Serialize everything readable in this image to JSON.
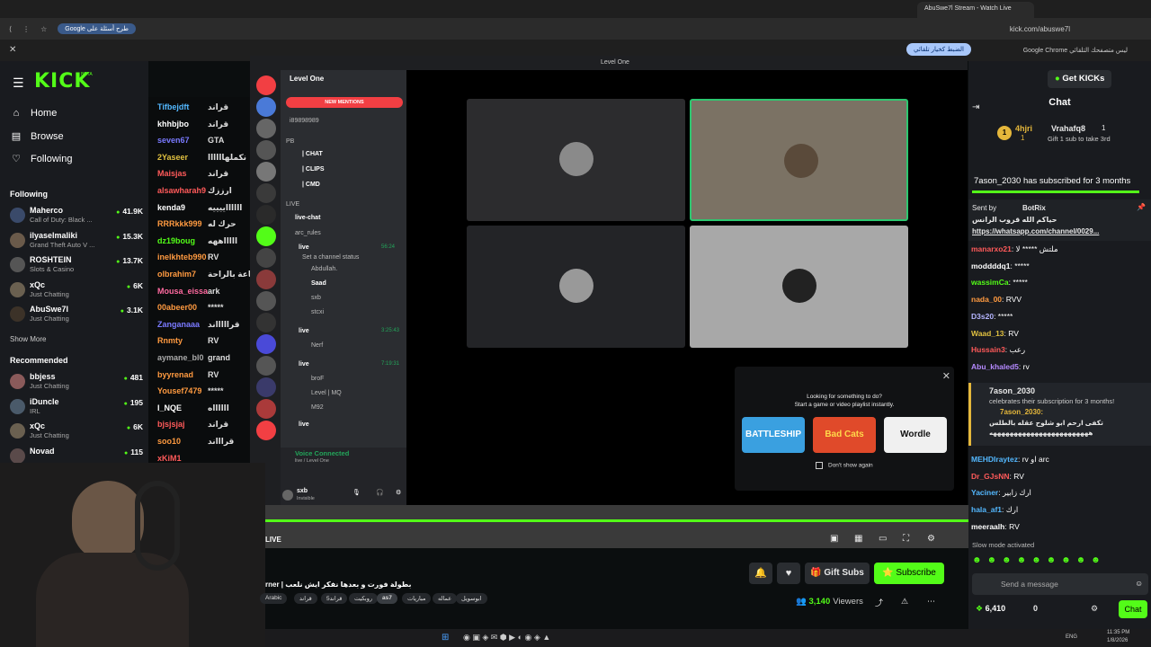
{
  "browser": {
    "tab_title": "AbuSwe7l Stream - Watch Live",
    "url": "kick.com/abuswe7l",
    "google_chip": "Google طرح أسئلة على",
    "infobar_msg": "Google Chrome ليس متصفحك التلقائي",
    "infobar_btn": "الضبط كخيار تلقائي"
  },
  "kick_left": {
    "logo": "KICK",
    "beta": "BETA",
    "nav": [
      {
        "label": "Home",
        "icon": "home-icon"
      },
      {
        "label": "Browse",
        "icon": "browse-icon"
      },
      {
        "label": "Following",
        "icon": "heart-icon"
      }
    ],
    "following_title": "Following",
    "following": [
      {
        "name": "Maherco",
        "cat": "Call of Duty: Black ...",
        "viewers": "41.9K",
        "color": "#3a4a6a"
      },
      {
        "name": "ilyaselmaliki",
        "cat": "Grand Theft Auto V ...",
        "viewers": "15.3K",
        "color": "#6a5a4a"
      },
      {
        "name": "ROSHTEIN",
        "cat": "Slots & Casino",
        "viewers": "13.7K",
        "color": "#555"
      },
      {
        "name": "xQc",
        "cat": "Just Chatting",
        "viewers": "6K",
        "color": "#6a6050"
      },
      {
        "name": "AbuSwe7l",
        "cat": "Just Chatting",
        "viewers": "3.1K",
        "color": "#3c3228"
      }
    ],
    "show_more": "Show More",
    "recommended_title": "Recommended",
    "recommended": [
      {
        "name": "bbjess",
        "cat": "Just Chatting",
        "viewers": "481",
        "color": "#8a5a5a"
      },
      {
        "name": "iDuncle",
        "cat": "IRL",
        "viewers": "195",
        "color": "#4a5a6a"
      },
      {
        "name": "xQc",
        "cat": "Just Chatting",
        "viewers": "6K",
        "color": "#6a6050"
      },
      {
        "name": "Novad",
        "cat": "",
        "viewers": "115",
        "color": "#5a4a4a"
      }
    ]
  },
  "overlay_chat": [
    {
      "user": "Tifbejdft",
      "text": "قراند",
      "color": "#53b8ff"
    },
    {
      "user": "khhbjbo",
      "text": "قراند",
      "color": "#ffffff"
    },
    {
      "user": "seven67",
      "text": "GTA",
      "color": "#7a7aff"
    },
    {
      "user": "2Yaseer",
      "text": "نكملهاااااا",
      "color": "#e0c040"
    },
    {
      "user": "Maisjas",
      "text": "قراند",
      "color": "#ff5a5a"
    },
    {
      "user": "alsawharah9",
      "text": "ارززك",
      "color": "#ff5a5a"
    },
    {
      "user": "kenda9",
      "text": "ااااااييييه",
      "color": "#ffffff"
    },
    {
      "user": "RRRkkk999",
      "text": "حرك له",
      "color": "#ff9a40"
    },
    {
      "user": "dz19boug",
      "text": "اااااههه",
      "color": "#53fc18"
    },
    {
      "user": "inelkhteb990",
      "text": "RV",
      "color": "#ff9a40"
    },
    {
      "user": "olbrahim7",
      "text": "ساعة بالراحة",
      "color": "#ff9a40"
    },
    {
      "user": "Mousa_eissa",
      "text": "ark",
      "color": "#ff6aa0"
    },
    {
      "user": "00abeer00",
      "text": "*****",
      "color": "#ff9a40"
    },
    {
      "user": "Zanganaaa",
      "text": "قراااااند",
      "color": "#7a7aff"
    },
    {
      "user": "Rnmty",
      "text": "RV",
      "color": "#ff9a40"
    },
    {
      "user": "aymane_bl0",
      "text": "grand",
      "color": "#aaaaaa"
    },
    {
      "user": "byyrenad",
      "text": "RV",
      "color": "#ff9a40"
    },
    {
      "user": "Yousef7479",
      "text": "*****",
      "color": "#ff9a40"
    },
    {
      "user": "I_NQE",
      "text": "ااااااه",
      "color": "#ffffff"
    },
    {
      "user": "bjsjsjaj",
      "text": "قراند",
      "color": "#ff5a5a"
    },
    {
      "user": "soo10",
      "text": "قراااند",
      "color": "#ff9a40"
    },
    {
      "user": "xKiM1",
      "text": "",
      "color": "#ff5a5a"
    }
  ],
  "discord": {
    "window_title": "Level One",
    "server_name": "Level One",
    "new_mentions": "NEW MENTIONS",
    "channels": [
      {
        "label": "i89898989",
        "bold": false
      },
      {
        "label": "PB",
        "bold": false
      },
      {
        "label": "| CHAT",
        "bold": true
      },
      {
        "label": "| CLIPS",
        "bold": true
      },
      {
        "label": "| CMD",
        "bold": true
      },
      {
        "label": "LIVE",
        "bold": false
      },
      {
        "label": "live-chat",
        "bold": true
      },
      {
        "label": "arc_rules",
        "bold": false
      },
      {
        "label": "live",
        "bold": true
      },
      {
        "label": "Set a channel status",
        "bold": false
      },
      {
        "label": "Abdullah.",
        "bold": false
      },
      {
        "label": "Saad",
        "bold": true
      },
      {
        "label": "sxb",
        "bold": false
      },
      {
        "label": "stcxi",
        "bold": false
      },
      {
        "label": "live",
        "bold": true
      },
      {
        "label": "Nerf",
        "bold": false
      },
      {
        "label": "live",
        "bold": true
      },
      {
        "label": "broF",
        "bold": false
      },
      {
        "label": "Level | MQ",
        "bold": false
      },
      {
        "label": "M92",
        "bold": false
      },
      {
        "label": "live",
        "bold": true
      }
    ],
    "timers": [
      "56:24",
      "3:25:43",
      "7:19:31"
    ],
    "voice_connected": "Voice Connected",
    "voice_sub": "live / Level One",
    "user": "sxb",
    "user_status": "Invisible",
    "activity_line1": "Looking for something to do?",
    "activity_line2": "Start a game or video playlist instantly.",
    "games": [
      {
        "label": "BATTLESHIP",
        "bg": "#3aa0e0",
        "fg": "#ffffff"
      },
      {
        "label": "Bad Cats",
        "bg": "#e04a2a",
        "fg": "#ffd94a"
      },
      {
        "label": "Wordle",
        "bg": "#f0f0f0",
        "fg": "#111111"
      }
    ],
    "dont_show": "Don't show again"
  },
  "stream": {
    "live_label": "LIVE",
    "title": "rner | بطولة فورت و بعدها نفكر ايش نلعب",
    "tags": [
      "Arabic",
      "قراند",
      "5قراند",
      "روبكيت",
      "as7",
      "مباريات",
      "عماله",
      "ابوسويل"
    ],
    "viewers": "3,140",
    "viewers_label": "Viewers",
    "gift_label": "Gift Subs",
    "sub_label": "Subscribe"
  },
  "chat": {
    "get_kicks": "Get KICKs",
    "header": "Chat",
    "top_gifters": [
      {
        "rank": "1",
        "name": "4hjri",
        "count": "1",
        "color": "#e5b73b"
      },
      {
        "rank": "",
        "name": "Vrahafq8",
        "count": "1",
        "color": "#ffffff"
      }
    ],
    "gift_prompt": "Gift 1 sub to take 3rd",
    "subscribe_banner": "7ason_2030 has subscribed for 3 months",
    "bot_sent_by": "Sent by",
    "bot_name": "BotRix",
    "bot_line1": "حياكم الله قروب الرانس",
    "bot_line2": "https://whatsapp.com/channel/0029...",
    "messages": [
      {
        "user": "manarxo21",
        "text": "ملتش ***** لا",
        "color": "#ff5a5a"
      },
      {
        "user": "moddddq1",
        "text": "*****",
        "color": "#ffffff"
      },
      {
        "user": "wassimCa",
        "text": "*****",
        "color": "#53fc18"
      },
      {
        "user": "nada_00",
        "text": "RVV",
        "color": "#ff9a40"
      },
      {
        "user": "D3s20",
        "text": "*****",
        "color": "#b5b5ff"
      },
      {
        "user": "Waad_13",
        "text": "RV",
        "color": "#e0c040"
      },
      {
        "user": "Hussain3",
        "text": "رعب",
        "color": "#ff5a5a"
      },
      {
        "user": "Abu_khaled5",
        "text": "rv",
        "color": "#b58aff"
      }
    ],
    "sub_card_user": "7ason_2030",
    "sub_card_text": "celebrates their subscription for 3 months!",
    "sub_card_msg_user": "7ason_2030:",
    "sub_card_msg": "تكفى ارحم ابو شلوح عقله بالطلس",
    "sub_card_msg2": "ههههههههههههههههههههههههه",
    "messages2": [
      {
        "user": "MEHDIraytez",
        "text": "rv او arc",
        "color": "#53b8ff"
      },
      {
        "user": "Dr_GJsNN",
        "text": "RV",
        "color": "#ff5a5a"
      },
      {
        "user": "Yaciner",
        "text": "ارك زابير",
        "color": "#53b8ff"
      },
      {
        "user": "hala_af1",
        "text": "ارك",
        "color": "#53b8ff"
      },
      {
        "user": "meeraalh",
        "text": "RV",
        "color": "#ffffff"
      }
    ],
    "slow_mode": "Slow mode activated",
    "placeholder": "Send a message",
    "kicks": "6,410",
    "zero": "0",
    "chat_btn": "Chat"
  },
  "taskbar": {
    "lang": "ENG",
    "time": "11:35 PM",
    "date": "1/8/2026"
  }
}
